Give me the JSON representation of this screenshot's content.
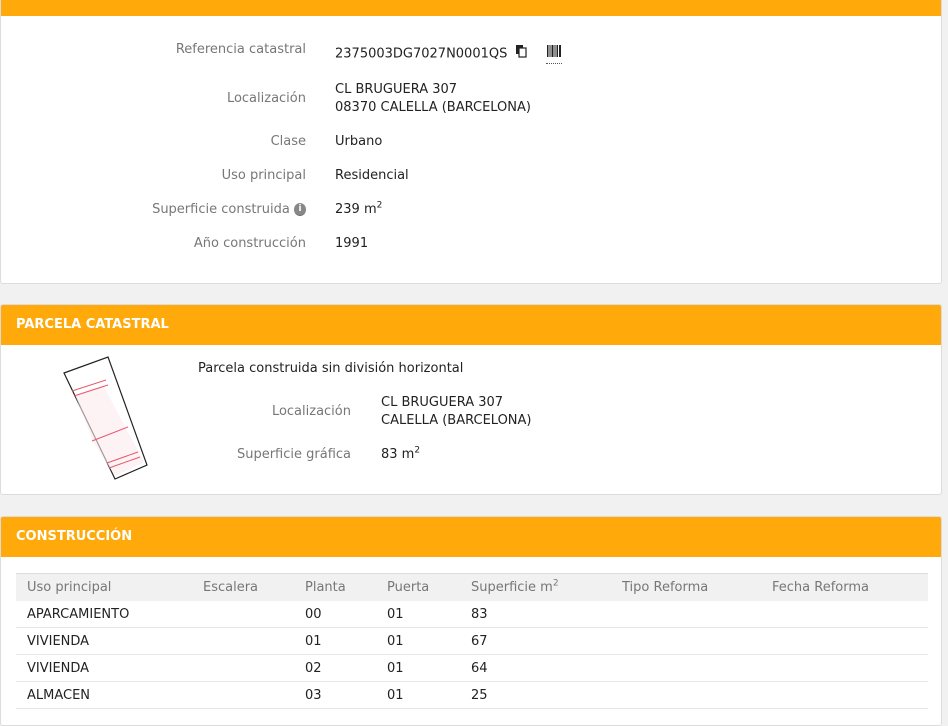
{
  "inmueble": {
    "fields": [
      {
        "label": "Referencia catastral",
        "value": "2375003DG7027N0001QS"
      },
      {
        "label": "Localización",
        "value": "CL BRUGUERA 307",
        "value2": "08370 CALELLA (BARCELONA)"
      },
      {
        "label": "Clase",
        "value": "Urbano"
      },
      {
        "label": "Uso principal",
        "value": "Residencial"
      },
      {
        "label": "Superficie construida",
        "value": "239 m",
        "unit_sup": "2"
      },
      {
        "label": "Año construcción",
        "value": "1991"
      }
    ],
    "icons": {
      "copy": "copy-icon",
      "barcode": "barcode-icon",
      "info": "info-icon"
    }
  },
  "parcela": {
    "title": "PARCELA CATASTRAL",
    "description": "Parcela construida sin división horizontal",
    "localizacion_label": "Localización",
    "localizacion_1": "CL BRUGUERA 307",
    "localizacion_2": "CALELLA (BARCELONA)",
    "superficie_label": "Superficie gráfica",
    "superficie_value": "83 m",
    "superficie_sup": "2"
  },
  "construccion": {
    "title": "CONSTRUCCIÓN",
    "headers": [
      "Uso principal",
      "Escalera",
      "Planta",
      "Puerta",
      "Superficie m",
      "Tipo Reforma",
      "Fecha Reforma"
    ],
    "superficie_sup": "2",
    "rows": [
      [
        "APARCAMIENTO",
        "",
        "00",
        "01",
        "83",
        "",
        ""
      ],
      [
        "VIVIENDA",
        "",
        "01",
        "01",
        "67",
        "",
        ""
      ],
      [
        "VIVIENDA",
        "",
        "02",
        "01",
        "64",
        "",
        ""
      ],
      [
        "ALMACEN",
        "",
        "03",
        "01",
        "25",
        "",
        ""
      ]
    ]
  },
  "colors": {
    "accent": "#ffa90a",
    "parcel_line": "#e8576b"
  }
}
